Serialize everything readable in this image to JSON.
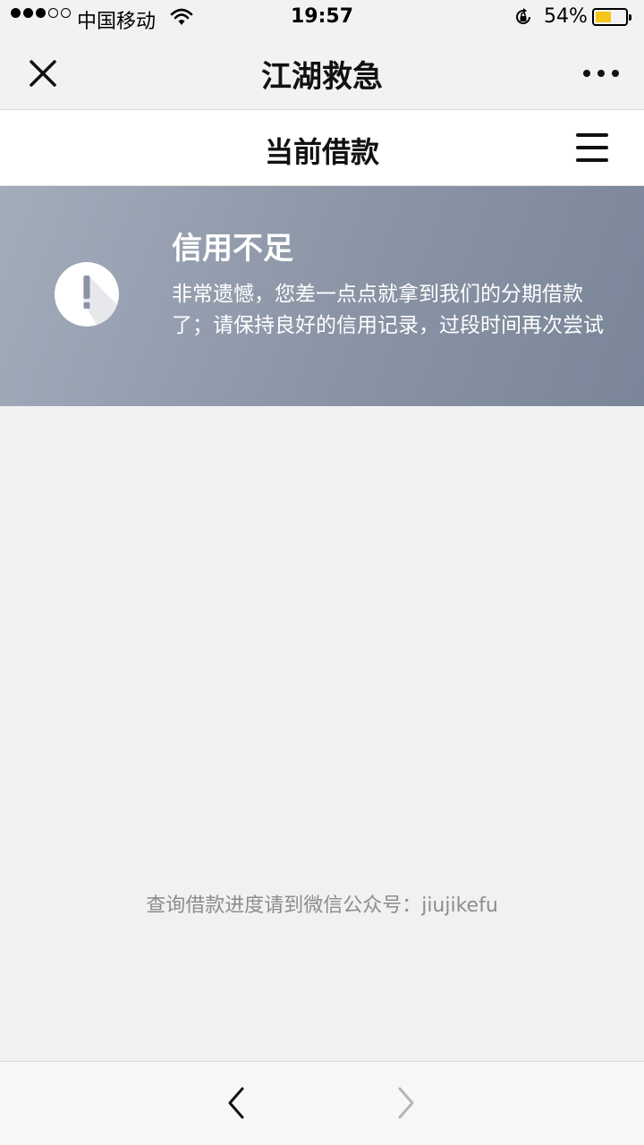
{
  "status_bar": {
    "carrier": "中国移动",
    "time": "19:57",
    "battery_percent": "54%",
    "battery_level": 0.54,
    "battery_color": "#f5c518",
    "signal_icons": [
      "dot-filled",
      "dot-filled",
      "dot-filled",
      "dot-empty",
      "dot-empty"
    ],
    "wifi_icon": "wifi-icon",
    "orientation_lock_icon": "rotation-lock-icon"
  },
  "nav_bar": {
    "title": "江湖救急",
    "close_icon": "close-icon",
    "more_icon": "more-dots-icon"
  },
  "page_header": {
    "title": "当前借款",
    "menu_icon": "hamburger-menu-icon"
  },
  "banner": {
    "icon": "exclamation-circle-icon",
    "title": "信用不足",
    "message": "非常遗憾，您差一点点就拿到我们的分期借款了；请保持良好的信用记录，过段时间再次尝试",
    "gradient": [
      "#a3acbb",
      "#7a8599"
    ]
  },
  "footer": {
    "note": "查询借款进度请到微信公众号：jiujikefu"
  },
  "bottom_bar": {
    "back_icon": "chevron-left-icon",
    "forward_icon": "chevron-right-icon"
  }
}
